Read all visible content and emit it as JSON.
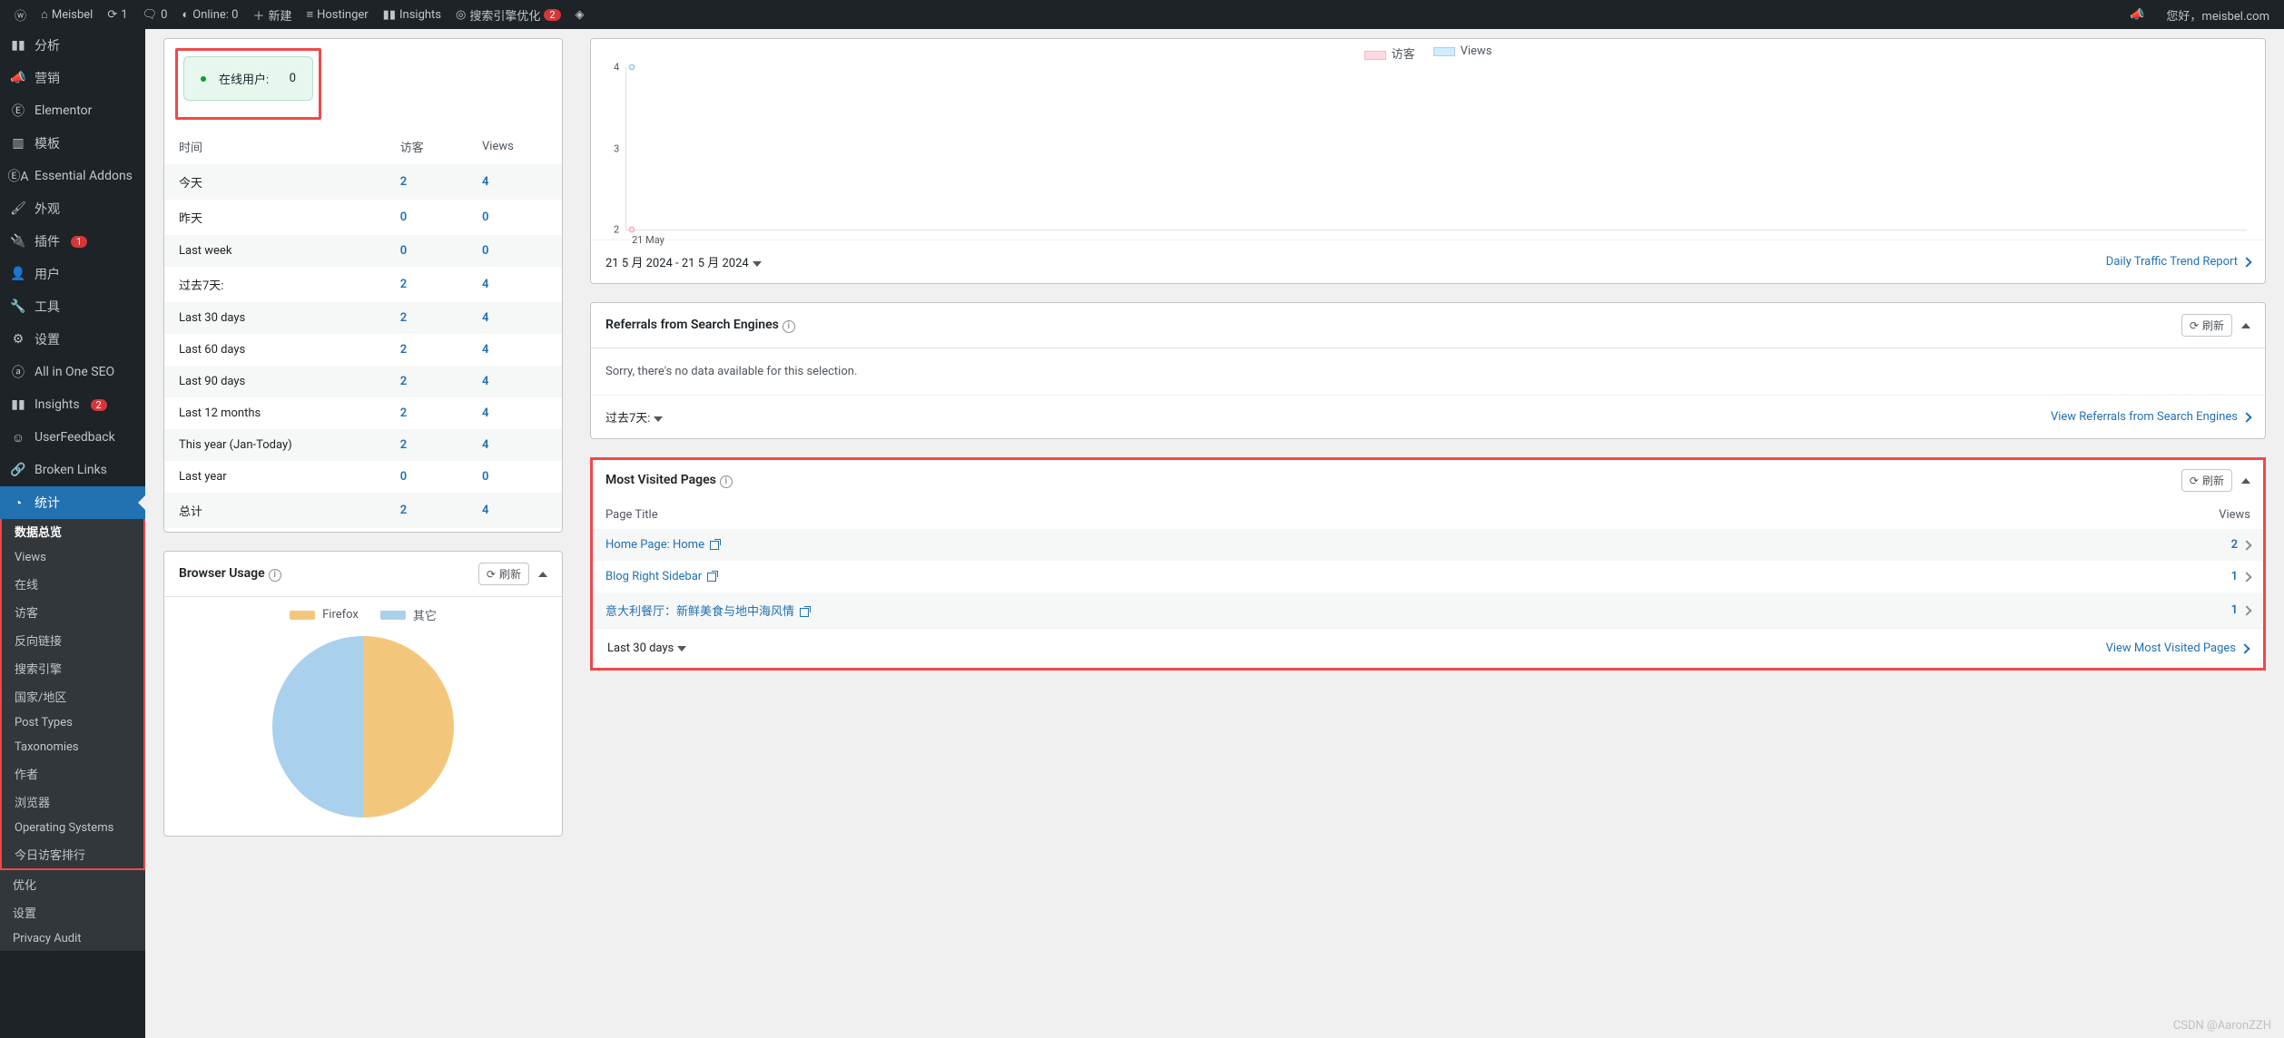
{
  "admin_bar": {
    "site_name": "Meisbel",
    "updates_count": "1",
    "comments_count": "0",
    "online_label": "Online: 0",
    "new_label": "新建",
    "hostinger": "Hostinger",
    "insights": "Insights",
    "seo": "搜索引擎优化",
    "seo_count": "2",
    "greeting": "您好，meisbel.com"
  },
  "sidebar": {
    "items": [
      {
        "label": "分析",
        "icon": "chart-bar"
      },
      {
        "label": "营销",
        "icon": "megaphone"
      },
      {
        "label": "Elementor",
        "icon": "elementor"
      },
      {
        "label": "模板",
        "icon": "template"
      },
      {
        "label": "Essential Addons",
        "icon": "ea"
      },
      {
        "label": "外观",
        "icon": "brush"
      },
      {
        "label": "插件",
        "icon": "plug",
        "count": "1"
      },
      {
        "label": "用户",
        "icon": "user"
      },
      {
        "label": "工具",
        "icon": "wrench"
      },
      {
        "label": "设置",
        "icon": "cog"
      },
      {
        "label": "All in One SEO",
        "icon": "aioseo"
      },
      {
        "label": "Insights",
        "icon": "insights",
        "count": "2"
      },
      {
        "label": "UserFeedback",
        "icon": "feedback"
      },
      {
        "label": "Broken Links",
        "icon": "link"
      },
      {
        "label": "统计",
        "icon": "stats",
        "active": true
      }
    ],
    "sub": [
      "数据总览",
      "Views",
      "在线",
      "访客",
      "反向链接",
      "搜索引擎",
      "国家/地区",
      "Post Types",
      "Taxonomies",
      "作者",
      "浏览器",
      "Operating Systems",
      "今日访客排行"
    ],
    "sub_tail": [
      "优化",
      "设置",
      "Privacy Audit"
    ]
  },
  "online_box": {
    "label": "在线用户:",
    "value": "0"
  },
  "stats_table": {
    "headers": [
      "时间",
      "访客",
      "Views"
    ],
    "rows": [
      {
        "label": "今天",
        "visitors": "2",
        "views": "4"
      },
      {
        "label": "昨天",
        "visitors": "0",
        "views": "0"
      },
      {
        "label": "Last week",
        "visitors": "0",
        "views": "0"
      },
      {
        "label": "过去7天:",
        "visitors": "2",
        "views": "4"
      },
      {
        "label": "Last 30 days",
        "visitors": "2",
        "views": "4"
      },
      {
        "label": "Last 60 days",
        "visitors": "2",
        "views": "4"
      },
      {
        "label": "Last 90 days",
        "visitors": "2",
        "views": "4"
      },
      {
        "label": "Last 12 months",
        "visitors": "2",
        "views": "4"
      },
      {
        "label": "This year (Jan-Today)",
        "visitors": "2",
        "views": "4"
      },
      {
        "label": "Last year",
        "visitors": "0",
        "views": "0"
      },
      {
        "label": "总计",
        "visitors": "2",
        "views": "4"
      }
    ]
  },
  "browser_panel": {
    "title": "Browser Usage",
    "refresh": "刷新",
    "legend": [
      {
        "label": "Firefox",
        "color": "#f3c77b"
      },
      {
        "label": "其它",
        "color": "#a9d0ec"
      }
    ]
  },
  "chart_data": [
    {
      "type": "pie",
      "title": "Browser Usage",
      "categories": [
        "Firefox",
        "其它"
      ],
      "values": [
        50,
        50
      ],
      "colors": [
        "#f3c77b",
        "#a9d0ec"
      ]
    },
    {
      "type": "line",
      "title": "Traffic",
      "x": [
        "21 May"
      ],
      "series": [
        {
          "name": "访客",
          "values": [
            2
          ],
          "color": "#ffb3c6"
        },
        {
          "name": "Views",
          "values": [
            4
          ],
          "color": "#a9d0ec"
        }
      ],
      "ylim": [
        2,
        4
      ],
      "yticks": [
        2,
        3,
        4
      ]
    }
  ],
  "traffic_panel": {
    "legend_visitors": "访客",
    "legend_views": "Views",
    "range": "21 5 月 2024 - 21 5 月 2024",
    "view_link": "Daily Traffic Trend Report"
  },
  "referrals_panel": {
    "title": "Referrals from Search Engines",
    "refresh": "刷新",
    "empty": "Sorry, there's no data available for this selection.",
    "footer_select": "过去7天:",
    "view_link": "View Referrals from Search Engines"
  },
  "mv_panel": {
    "title": "Most Visited Pages",
    "refresh": "刷新",
    "col_title": "Page Title",
    "col_views": "Views",
    "rows": [
      {
        "title": "Home Page: Home",
        "views": "2"
      },
      {
        "title": "Blog Right Sidebar",
        "views": "1"
      },
      {
        "title": "意大利餐厅：新鲜美食与地中海风情",
        "views": "1"
      }
    ],
    "footer_select": "Last 30 days",
    "view_link": "View Most Visited Pages"
  },
  "watermark": "CSDN @AaronZZH"
}
